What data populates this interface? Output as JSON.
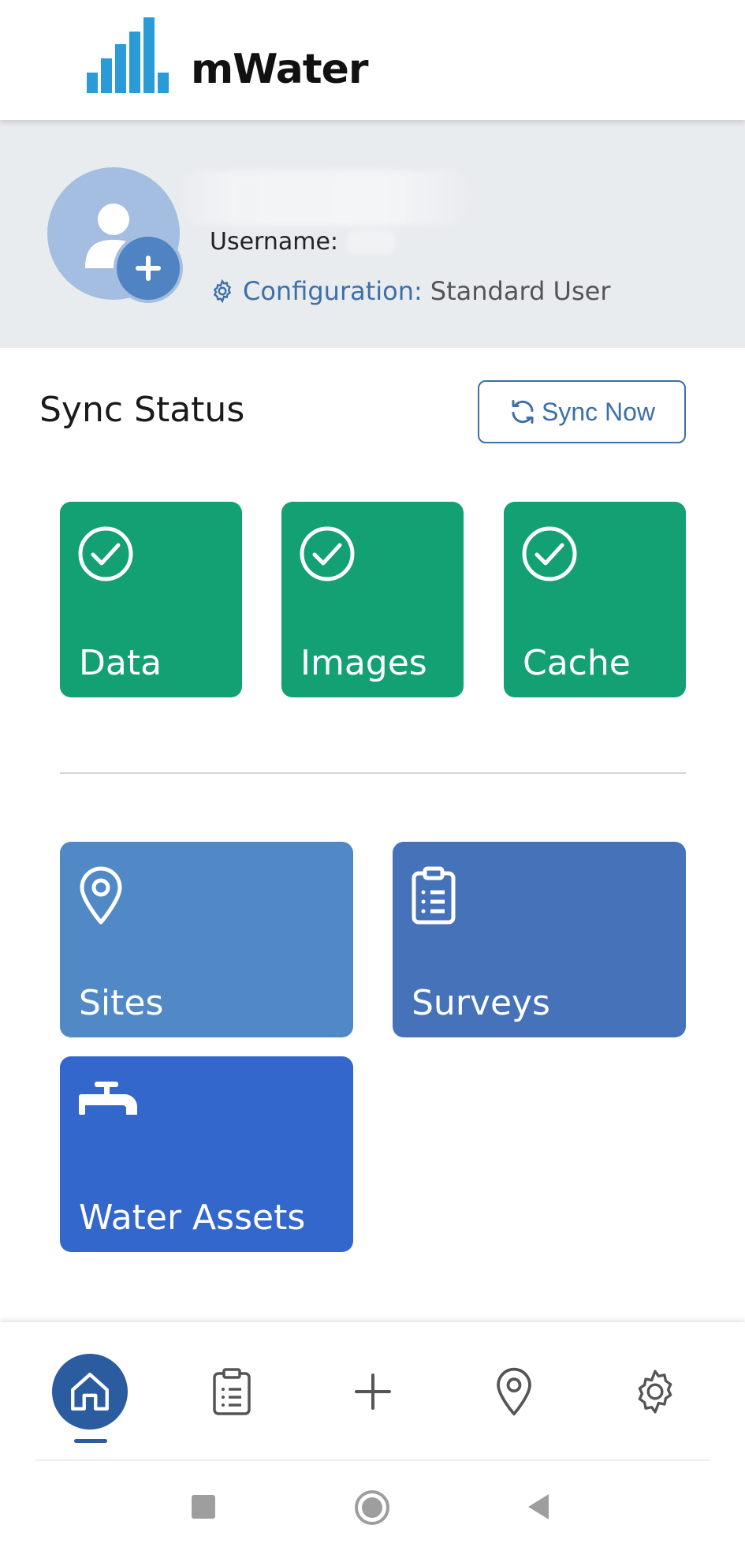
{
  "header": {
    "logo_text": "mWater"
  },
  "profile": {
    "username_label": "Username:",
    "config_label": "Configuration:",
    "config_value": "Standard User",
    "avatar_icon": "add-user-icon"
  },
  "sync": {
    "title": "Sync Status",
    "button_label": "Sync Now",
    "tiles": [
      {
        "label": "Data",
        "icon": "check-circle-icon",
        "status": "synced"
      },
      {
        "label": "Images",
        "icon": "check-circle-icon",
        "status": "synced"
      },
      {
        "label": "Cache",
        "icon": "check-circle-icon",
        "status": "synced"
      }
    ]
  },
  "modules": [
    {
      "label": "Sites",
      "icon": "map-pin-icon",
      "color": "#5189c6"
    },
    {
      "label": "Surveys",
      "icon": "clipboard-icon",
      "color": "#4672b9"
    },
    {
      "label": "Water Assets",
      "icon": "faucet-icon",
      "color": "#3367cc"
    }
  ],
  "tabbar": {
    "items": [
      {
        "name": "home",
        "icon": "home-icon",
        "active": true
      },
      {
        "name": "surveys",
        "icon": "clipboard-icon",
        "active": false
      },
      {
        "name": "add",
        "icon": "plus-icon",
        "active": false
      },
      {
        "name": "map",
        "icon": "map-pin-icon",
        "active": false
      },
      {
        "name": "settings",
        "icon": "gear-icon",
        "active": false
      }
    ]
  },
  "colors": {
    "brand_blue": "#3d6fa8",
    "status_green": "#13a072",
    "active_tab": "#2b5c9f",
    "logo_blue": "#2b9bd8"
  }
}
